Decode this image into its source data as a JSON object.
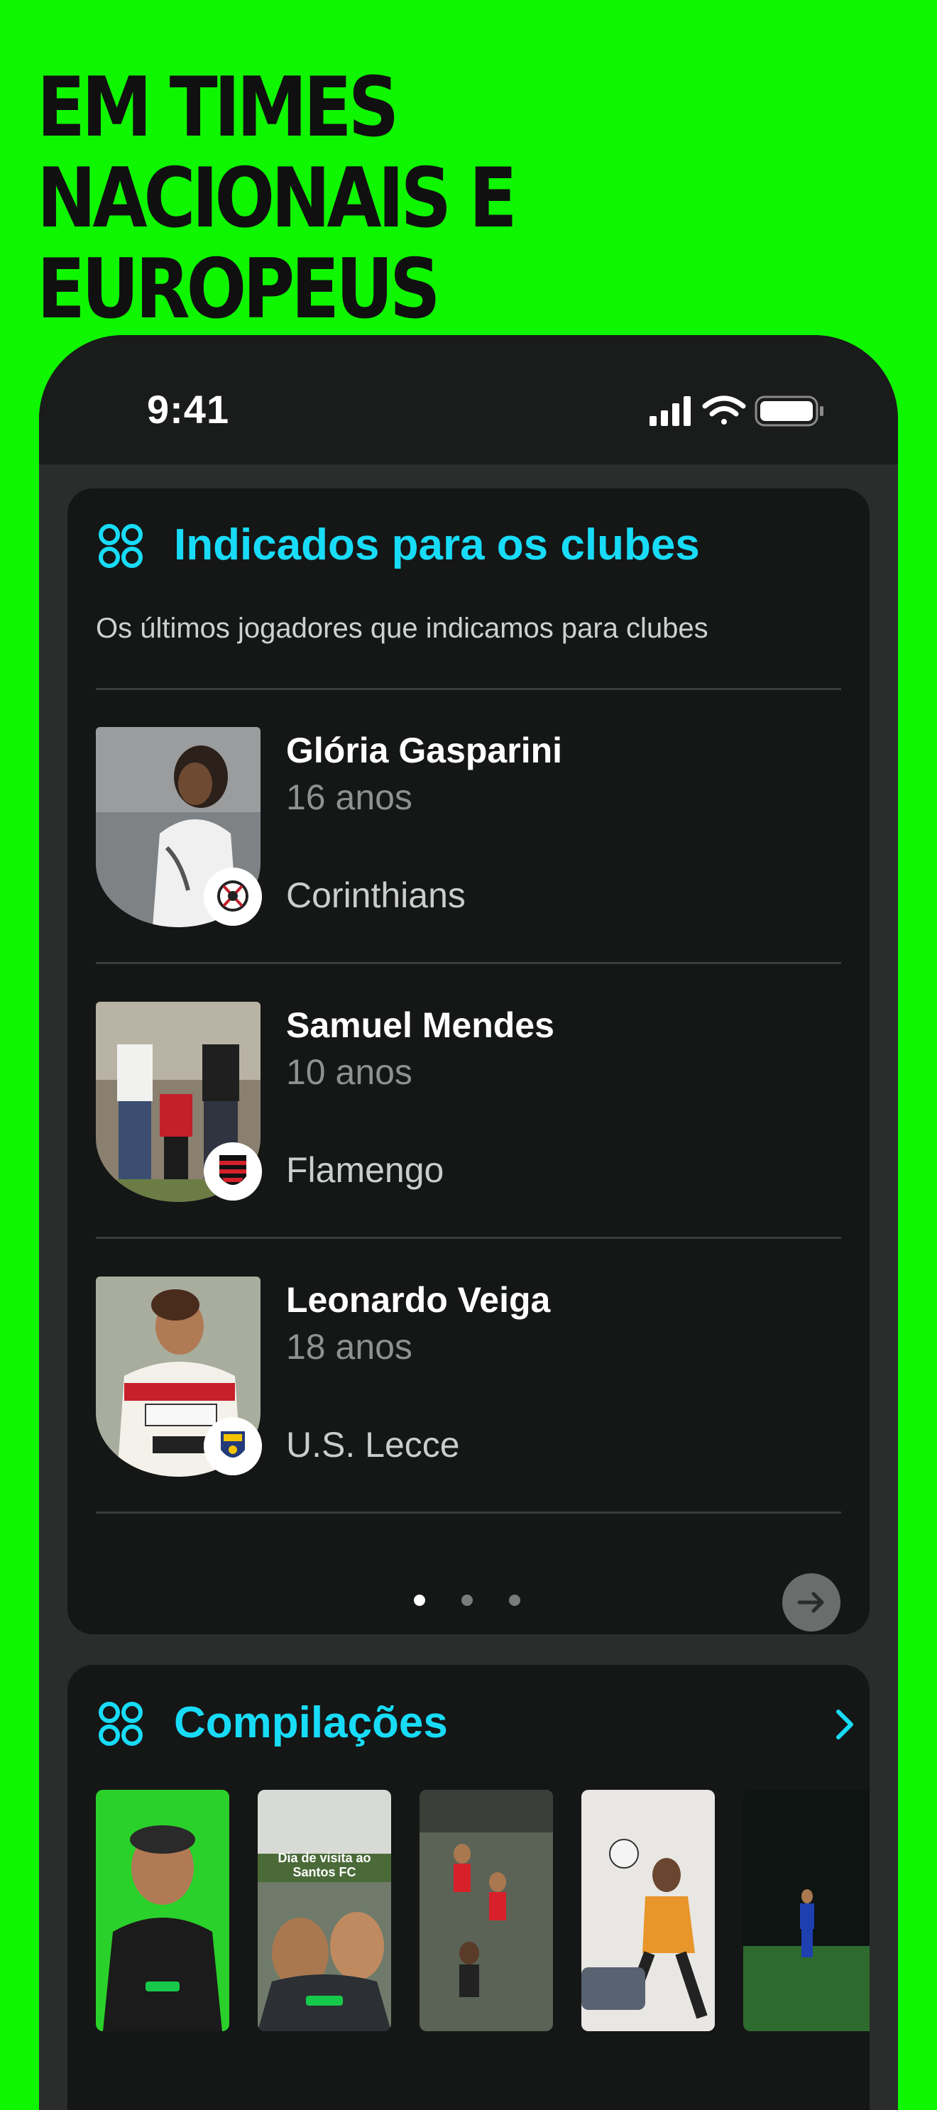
{
  "headline": "EM TIMES NACIONAIS E EUROPEUS",
  "status_bar": {
    "time": "9:41"
  },
  "indicados": {
    "title": "Indicados para os clubes",
    "subtitle": "Os últimos jogadores que indicamos para clubes",
    "players": [
      {
        "name": "Glória Gasparini",
        "age": "16 anos",
        "club": "Corinthians"
      },
      {
        "name": "Samuel Mendes",
        "age": "10 anos",
        "club": "Flamengo"
      },
      {
        "name": "Leonardo Veiga",
        "age": "18 anos",
        "club": "U.S. Lecce"
      }
    ],
    "pagination": {
      "pages": 3,
      "current": 1
    }
  },
  "compilacoes": {
    "title": "Compilações",
    "clips": [
      {
        "caption": ""
      },
      {
        "caption": "Dia de visita ao Santos FC"
      },
      {
        "caption": ""
      },
      {
        "caption": ""
      },
      {
        "caption": ""
      }
    ]
  },
  "colors": {
    "background": "#0ff700",
    "accent": "#18dcf7",
    "card": "#151616"
  },
  "icons": [
    "apps-grid-icon",
    "signal-icon",
    "wifi-icon",
    "battery-icon",
    "arrow-right-icon",
    "chevron-right-icon"
  ]
}
